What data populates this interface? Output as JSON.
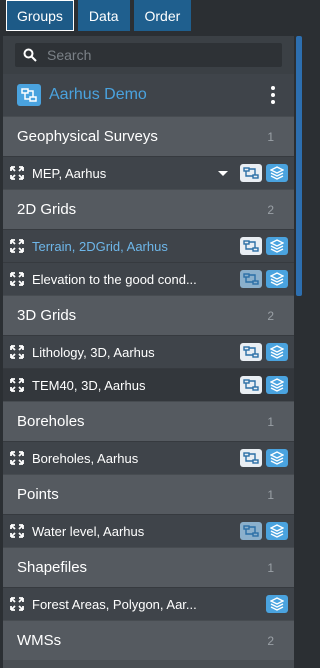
{
  "tabs": [
    "Groups",
    "Data",
    "Order"
  ],
  "search": {
    "placeholder": "Search"
  },
  "project": {
    "title": "Aarhus Demo"
  },
  "groups": [
    {
      "label": "Geophysical Surveys",
      "count": "1"
    },
    {
      "label": "2D Grids",
      "count": "2"
    },
    {
      "label": "3D Grids",
      "count": "2"
    },
    {
      "label": "Boreholes",
      "count": "1"
    },
    {
      "label": "Points",
      "count": "1"
    },
    {
      "label": "Shapefiles",
      "count": "1"
    },
    {
      "label": "WMSs",
      "count": "2"
    }
  ],
  "layers": {
    "mep": "MEP, Aarhus",
    "terrain": "Terrain, 2DGrid, Aarhus",
    "elevation": "Elevation to the good cond...",
    "lithology": "Lithology, 3D, Aarhus",
    "tem40": "TEM40, 3D, Aarhus",
    "boreholes": "Boreholes, Aarhus",
    "water": "Water level, Aarhus",
    "forest": "Forest Areas, Polygon, Aar..."
  },
  "colors": {
    "accent": "#4aa3df",
    "tab_bg": "#1f5f8e",
    "panel_bg": "#4a4f54"
  }
}
